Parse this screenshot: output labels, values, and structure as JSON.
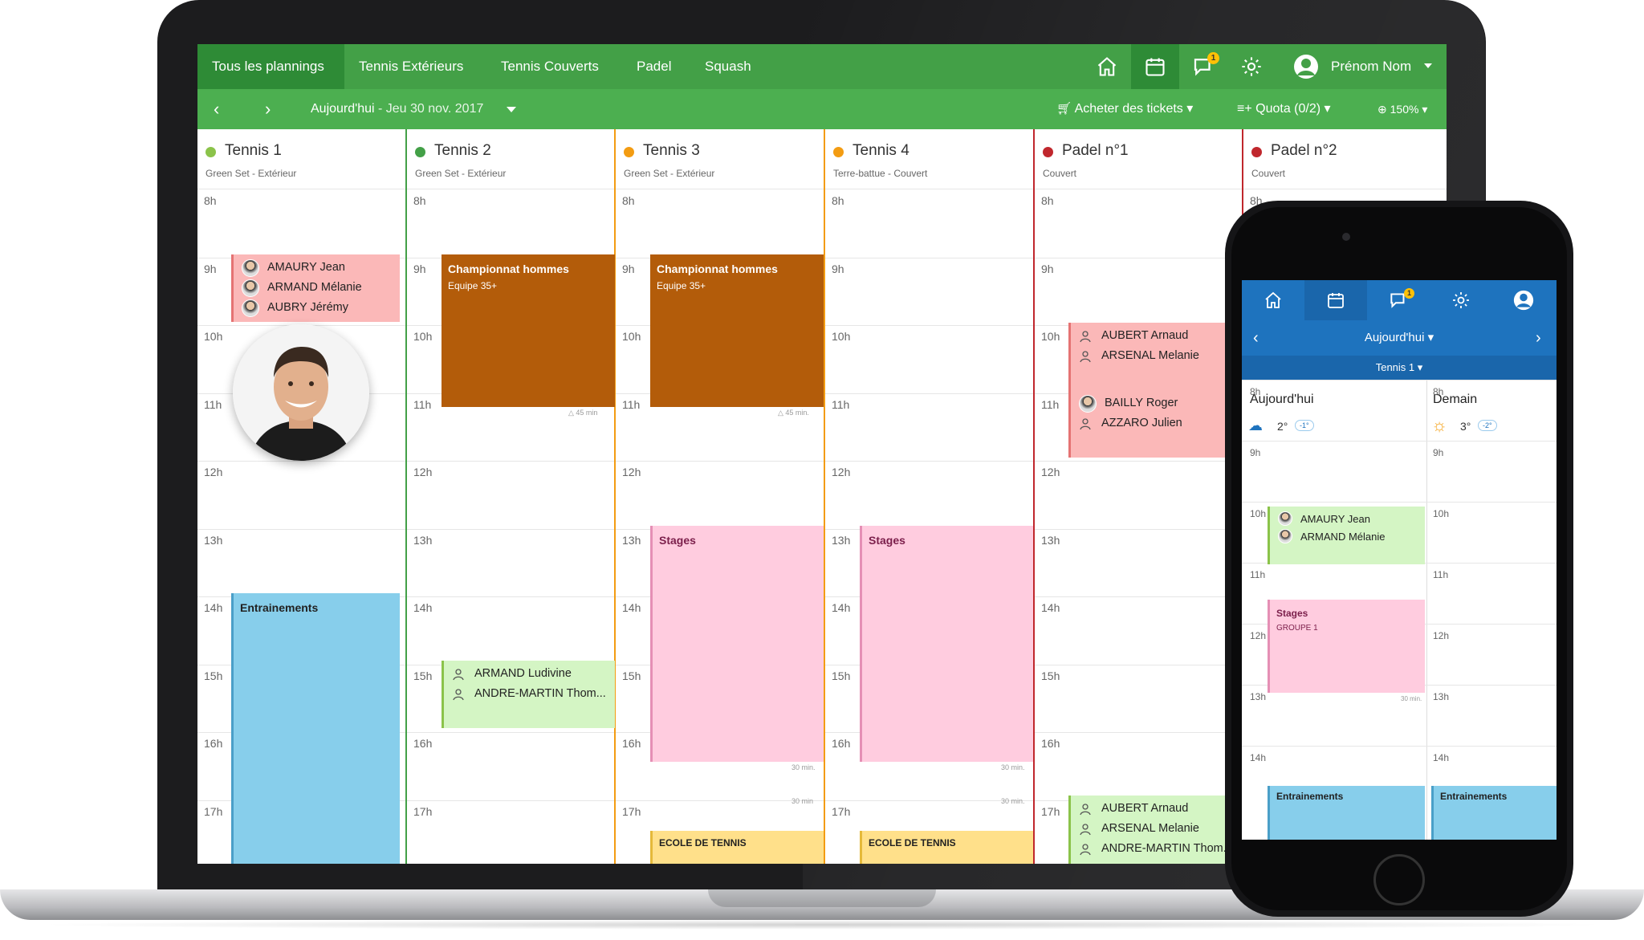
{
  "topbar": {
    "tabs": [
      "Tous les plannings",
      "Tennis Extérieurs",
      "Tennis Couverts",
      "Padel",
      "Squash"
    ],
    "user_name": "Prénom Nom",
    "notif_count": "1"
  },
  "subbar": {
    "today": "Aujourd'hui",
    "date": " - Jeu 30 nov. 2017",
    "buy": "Acheter des tickets",
    "quota": "Quota (0/2)",
    "zoom": "150%"
  },
  "hours": [
    "8h",
    "9h",
    "10h",
    "11h",
    "12h",
    "13h",
    "14h",
    "15h",
    "16h",
    "17h"
  ],
  "columns": [
    {
      "name": "Tennis 1",
      "sub": "Green Set - Extérieur",
      "color": "#8bc34a"
    },
    {
      "name": "Tennis 2",
      "sub": "Green Set - Extérieur",
      "color": "#43a047"
    },
    {
      "name": "Tennis 3",
      "sub": "Green Set - Extérieur",
      "color": "#f39c12"
    },
    {
      "name": "Tennis 4",
      "sub": "Terre-battue - Couvert",
      "color": "#f39c12"
    },
    {
      "name": "Padel n°1",
      "sub": "Couvert",
      "color": "#c0272d"
    },
    {
      "name": "Padel n°2",
      "sub": "Couvert",
      "color": "#c0272d"
    }
  ],
  "events": {
    "t1_players": [
      "AMAURY Jean",
      "ARMAND Mélanie",
      "AUBRY Jérémy"
    ],
    "t1_training": "Entrainements",
    "t2_champ": "Championnat hommes",
    "t2_champ_sub": "Equipe 35+",
    "t2_champ_dur": "45 min",
    "t2_players": [
      "ARMAND Ludivine",
      "ANDRE-MARTIN Thom..."
    ],
    "t3_champ": "Championnat hommes",
    "t3_champ_sub": "Equipe 35+",
    "t3_champ_dur": "45 min.",
    "t3_stages": "Stages",
    "t3_dur1": "30 min.",
    "t3_dur2": "30 min",
    "t3_ecole": "ECOLE DE TENNIS",
    "t4_stages": "Stages",
    "t4_dur1": "30 min.",
    "t4_dur2": "30 min.",
    "t4_ecole": "ECOLE DE TENNIS",
    "p1_a": [
      "AUBERT Arnaud",
      "ARSENAL Melanie"
    ],
    "p1_b": [
      "BAILLY Roger",
      "AZZARO Julien"
    ],
    "p1_c": [
      "AUBERT Arnaud",
      "ARSENAL Melanie",
      "ANDRE-MARTIN Thom..."
    ]
  },
  "phone": {
    "notif_count": "1",
    "today": "Aujourd'hui",
    "court": "Tennis 1",
    "day1": {
      "label": "Aujourd'hui",
      "temp": "2°",
      "temp2": "-1°"
    },
    "day2": {
      "label": "Demain",
      "temp": "3°",
      "temp2": "-2°"
    },
    "hours": [
      "8h",
      "9h",
      "10h",
      "11h",
      "12h",
      "13h",
      "14h"
    ],
    "players": [
      "AMAURY Jean",
      "ARMAND Mélanie"
    ],
    "stages": "Stages",
    "stages_sub": "GROUPE 1",
    "dur": "30 min.",
    "training1": "Entrainements",
    "training2": "Entrainements"
  },
  "colors": {
    "green_dark": "#2e8b36",
    "green": "#43a047",
    "blue": "#1e73be",
    "orange": "#b35c0a",
    "pink": "#ffccdf",
    "lightgreen": "#d4f5c4",
    "salmon": "#fbb8b8",
    "sky": "#87ceeb",
    "yellow": "#ffe08a"
  }
}
